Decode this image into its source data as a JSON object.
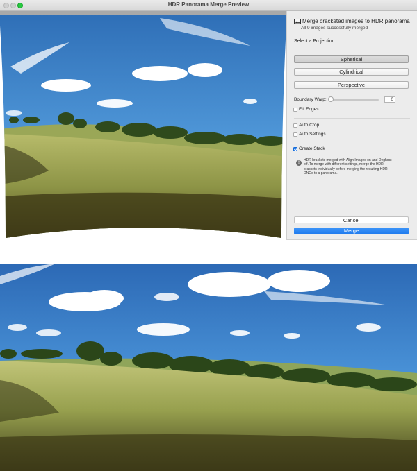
{
  "window": {
    "title": "HDR Panorama Merge Preview"
  },
  "status": {
    "icon": "image-stack-icon",
    "title": "Merge bracketed images to HDR panorama",
    "subtitle": "All 9 images successfully merged"
  },
  "projection": {
    "label": "Select a Projection",
    "options": [
      "Spherical",
      "Cylindrical",
      "Perspective"
    ],
    "selected": "Spherical"
  },
  "boundary_warp": {
    "label": "Boundary Warp:",
    "value": "0"
  },
  "options": {
    "fill_edges": {
      "label": "Fill Edges",
      "checked": false
    },
    "auto_crop": {
      "label": "Auto Crop",
      "checked": false
    },
    "auto_settings": {
      "label": "Auto Settings",
      "checked": false
    },
    "create_stack": {
      "label": "Create Stack",
      "checked": true
    }
  },
  "info": {
    "icon": "info-icon",
    "text": "HDR brackets merged with Align Images on and Deghost off. To merge with different settings, merge the HDR brackets individually before merging the resulting HDR DNGs to a panorama."
  },
  "buttons": {
    "cancel": "Cancel",
    "merge": "Merge"
  },
  "colors": {
    "accent": "#1f7cf1",
    "close_light": "#cfcfcf",
    "zoom_light": "#27c93f",
    "sky": "#3f86cc",
    "field": "#a9ad5e"
  }
}
